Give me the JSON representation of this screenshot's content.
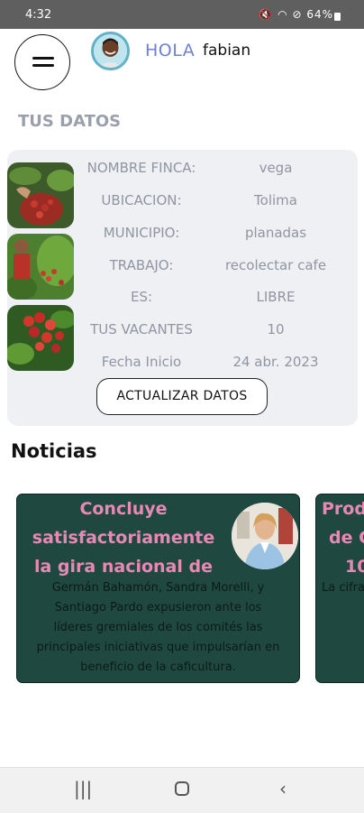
{
  "status_bar": {
    "time": "4:32",
    "battery": "64%"
  },
  "header": {
    "greeting": "HOLA",
    "user_name": "fabian"
  },
  "section_title": "TUS DATOS",
  "farm": {
    "rows": [
      {
        "label": "NOMBRE FINCA:",
        "value": "vega"
      },
      {
        "label": "UBICACION:",
        "value": "Tolima"
      },
      {
        "label": "MUNICIPIO:",
        "value": "planadas"
      },
      {
        "label": "TRABAJO:",
        "value": "recolectar cafe"
      },
      {
        "label": "ES:",
        "value": "LIBRE"
      },
      {
        "label": "TUS VACANTES",
        "value": "10"
      },
      {
        "label": "Fecha Inicio",
        "value": "24 abr. 2023"
      }
    ],
    "update_button": "ACTUALIZAR DATOS"
  },
  "news": {
    "title": "Noticias",
    "cards": [
      {
        "headline_lines": [
          "Concluye",
          "satisfactoriamente",
          "la gira nacional de"
        ],
        "summary_lines": [
          "Germán Bahamón, Sandra Morelli, y",
          "Santiago Pardo expusieron ante los",
          "líderes gremiales de los comités las",
          "principales iniciativas que impulsarían en",
          "beneficio de la caficultura."
        ]
      },
      {
        "headline_lines": [
          "Prod",
          "de C",
          "10"
        ],
        "summary_lines": [
          "La cifra"
        ]
      }
    ]
  },
  "colors": {
    "accent": "#6f80d8",
    "card_bg": "#1f4940",
    "headline": "#e889b4",
    "label": "#8f96a2"
  }
}
